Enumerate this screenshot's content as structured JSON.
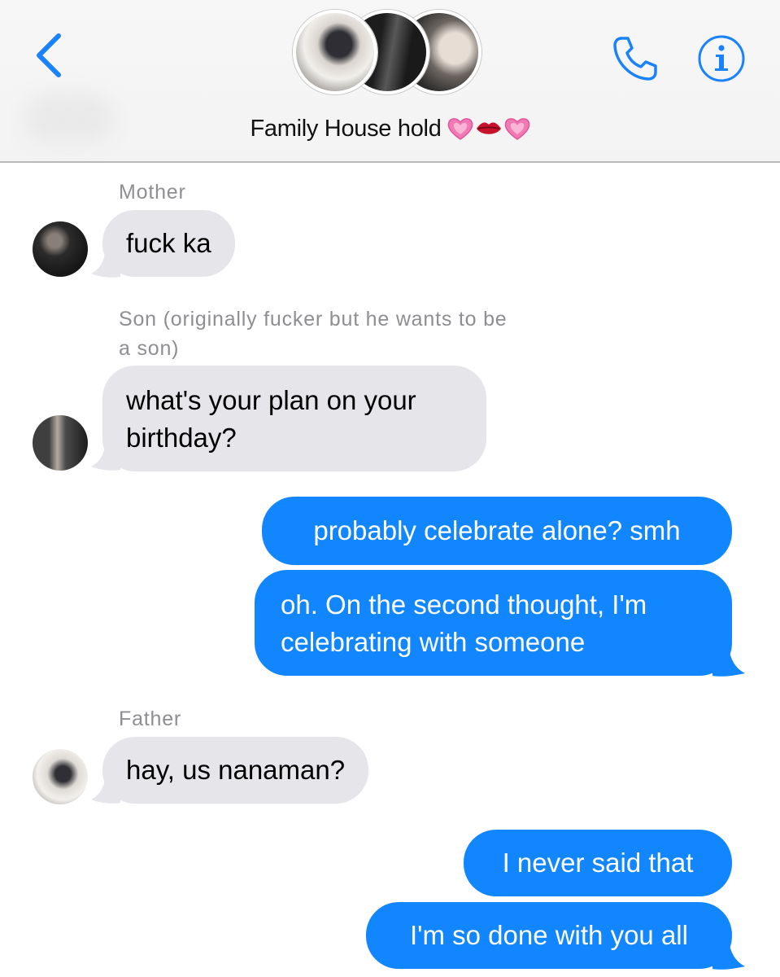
{
  "header": {
    "title": "Family House hold",
    "title_emojis": [
      "heart-emoji",
      "lips-emoji",
      "heart-emoji"
    ],
    "icons": {
      "back": "chevron-left-icon",
      "call": "phone-icon",
      "info": "info-icon"
    },
    "accent_color": "#1a82fb"
  },
  "messages": [
    {
      "sender": "Mother",
      "direction": "incoming",
      "text": "fuck ka"
    },
    {
      "sender": "Son (originally fucker but he wants to be a son)",
      "direction": "incoming",
      "lines": [
        "what's your plan on your",
        "birthday?"
      ]
    },
    {
      "direction": "outgoing",
      "text": "probably celebrate alone? smh"
    },
    {
      "direction": "outgoing",
      "lines": [
        "oh. On the second thought, I'm",
        "celebrating with someone"
      ]
    },
    {
      "sender": "Father",
      "direction": "incoming",
      "text": "hay, us nanaman?"
    },
    {
      "direction": "outgoing",
      "text": "I never said that"
    },
    {
      "direction": "outgoing",
      "text": "I'm so done with you all"
    }
  ],
  "sender_line_wrap": [
    "Son (originally fucker but he wants to be",
    "a son)"
  ],
  "colors": {
    "incoming_bubble": "#e5e5ea",
    "outgoing_bubble": "#1286ff",
    "sender_label": "#8e8e93"
  }
}
